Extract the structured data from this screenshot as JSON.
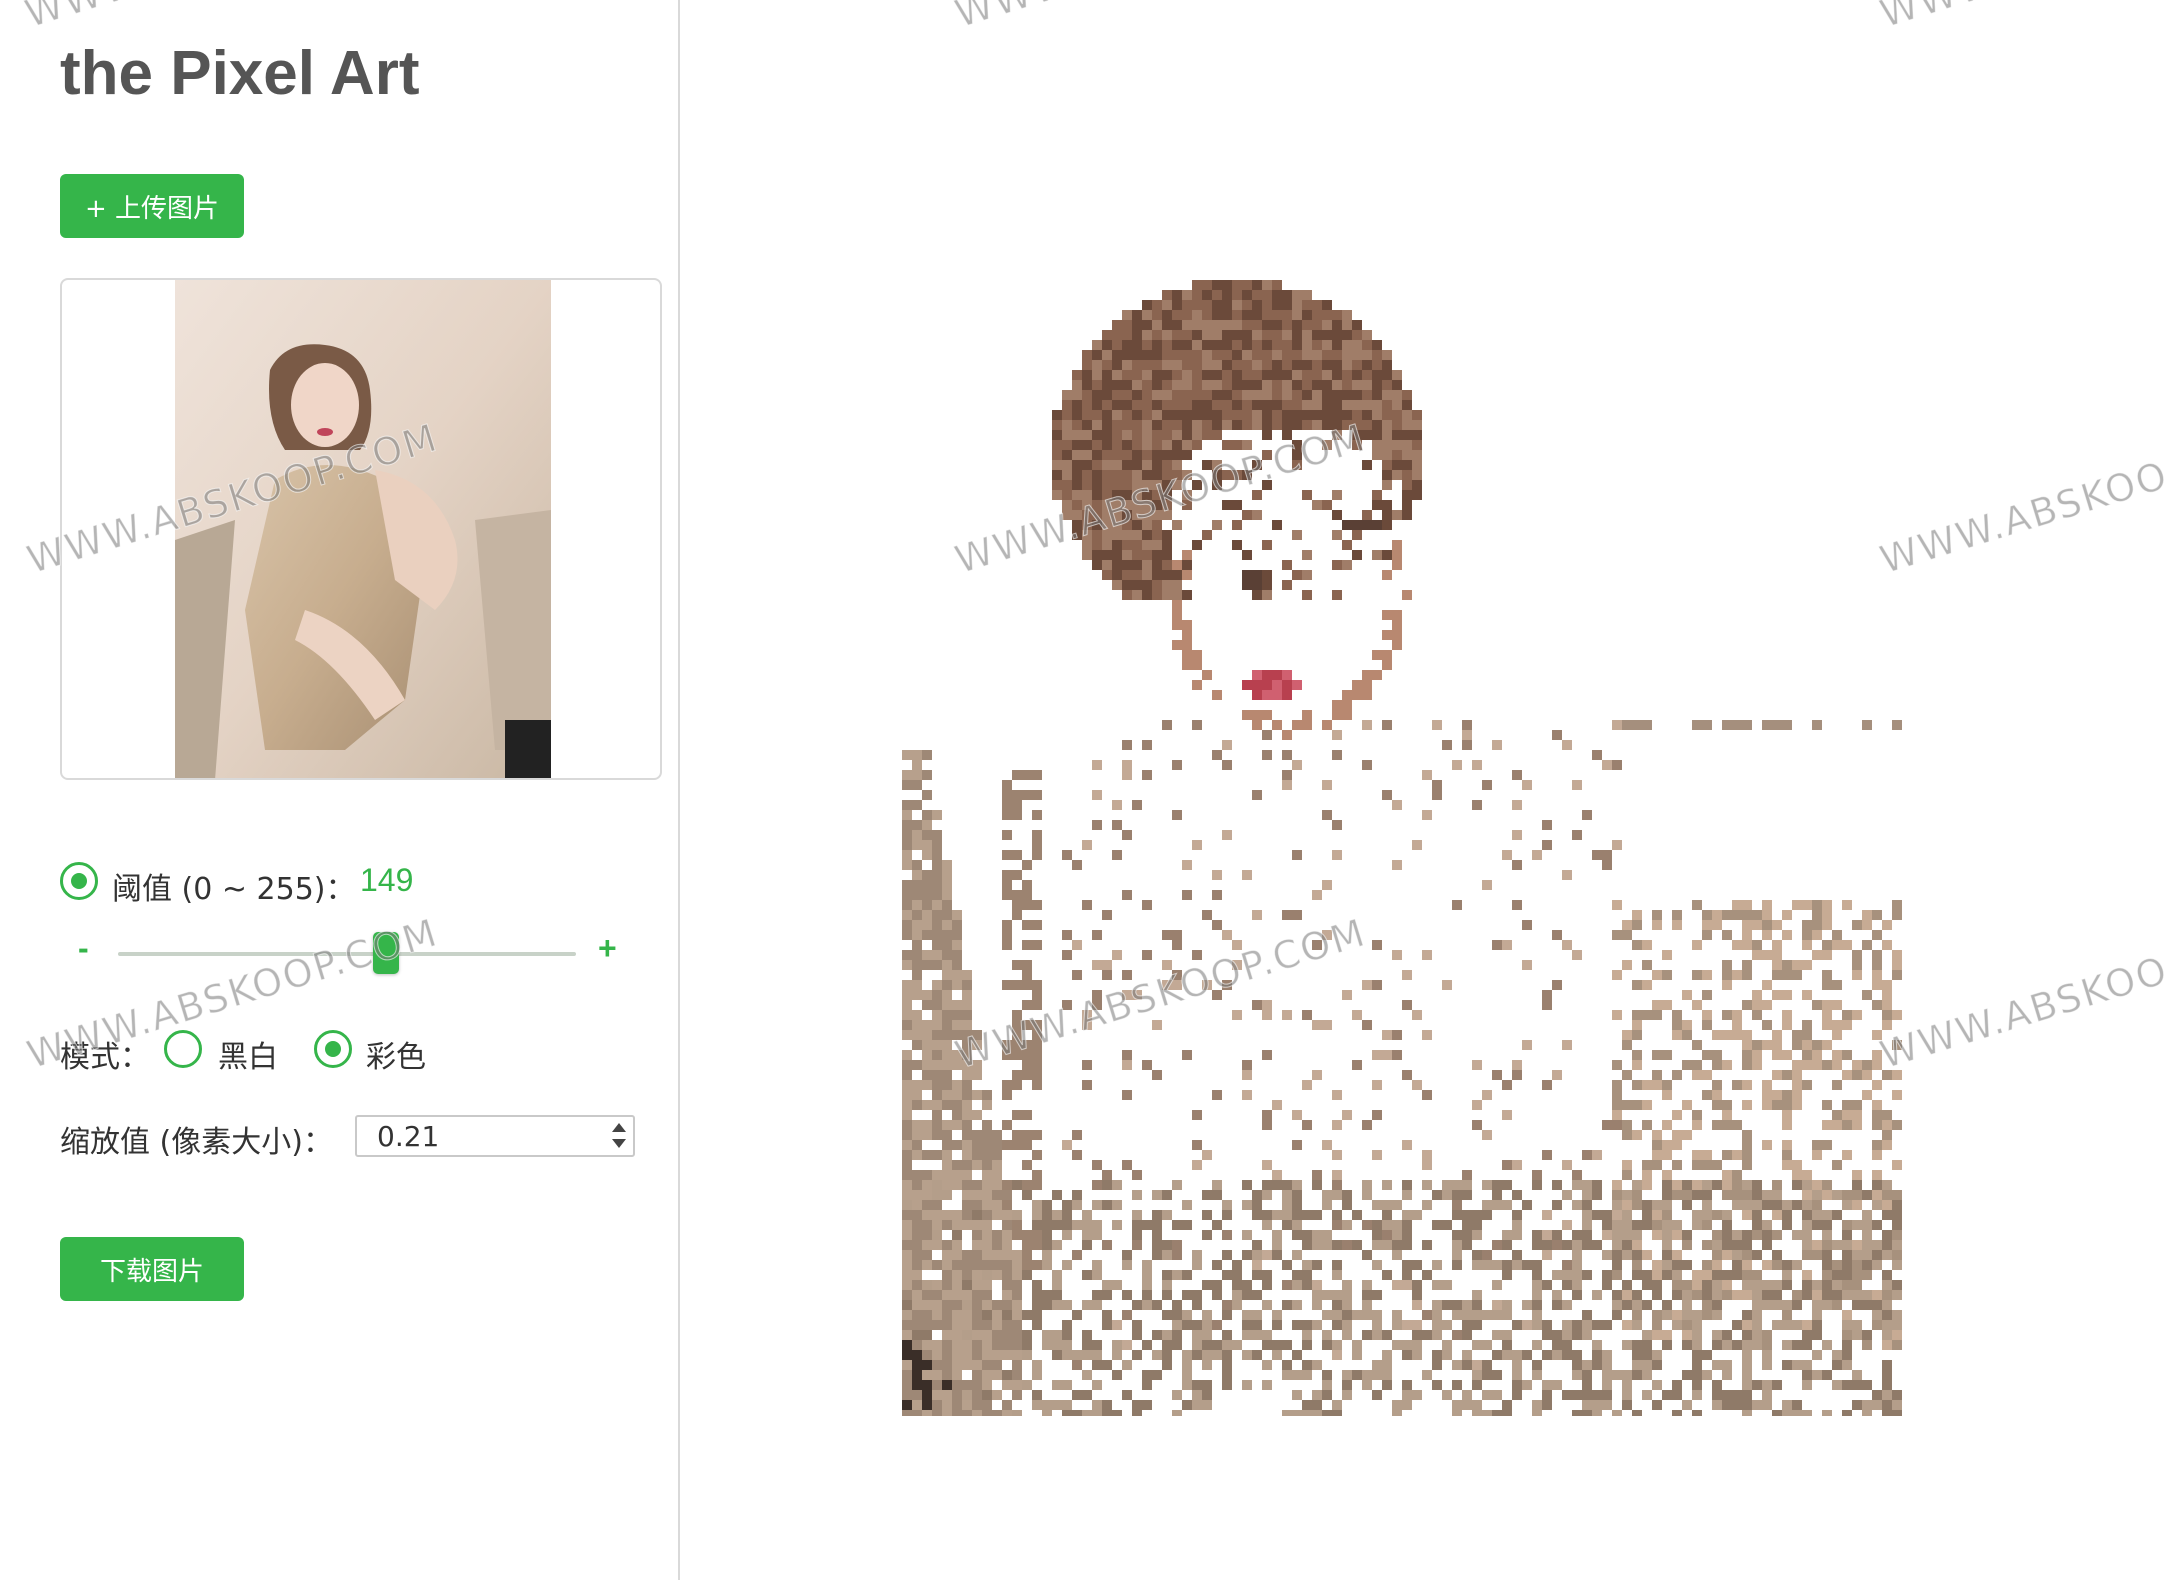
{
  "app": {
    "title": "the Pixel Art"
  },
  "actions": {
    "upload_label": "+ 上传图片",
    "download_label": "下载图片"
  },
  "threshold": {
    "label": "阈值 (0 ~ 255)：",
    "value": "149",
    "min_symbol": "-",
    "max_symbol": "+",
    "min": 0,
    "max": 255,
    "current": 149
  },
  "mode": {
    "label": "模式：",
    "options": [
      {
        "label": "黑白",
        "selected": false
      },
      {
        "label": "彩色",
        "selected": true
      }
    ]
  },
  "scale": {
    "label": "缩放值 (像素大小)：",
    "value": "0.21"
  },
  "watermark": {
    "text": "WWW.ABSKOOP.COM",
    "text_cut": "WWW.ABSKOO",
    "text_top": "WWW.A"
  },
  "colors": {
    "accent": "#35b54a",
    "title": "#555555",
    "border": "#d9d9d9"
  },
  "icons": {
    "upload": "plus-icon",
    "spinner": "spinner-arrows-icon"
  }
}
